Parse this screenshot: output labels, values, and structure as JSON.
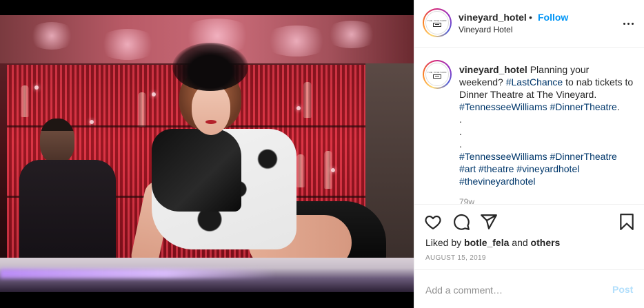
{
  "post": {
    "image_alt": "Performer in feathered hat reclining on a bar in front of a red tinsel backdrop"
  },
  "header": {
    "username": "vineyard_hotel",
    "separator": "•",
    "follow_label": "Follow",
    "location": "Vineyard Hotel",
    "avatar_logo_text": "THE VINEYARD"
  },
  "caption": {
    "username": "vineyard_hotel",
    "text_1": " Planning your weekend? ",
    "tag_1": "#LastChance",
    "text_2": " to nab tickets to Dinner Theatre at The Vineyard.",
    "tag_2": "#TennesseeWilliams",
    "tag_3": "#DinnerTheatre",
    "period": ".",
    "dot_1": ".",
    "dot_2": ".",
    "dot_3": ".",
    "tag_4": "#TennesseeWilliams",
    "tag_5": "#DinnerTheatre",
    "tag_6": "#art",
    "tag_7": "#theatre",
    "tag_8": "#vineyardhotel",
    "tag_9": "#thevineyardhotel",
    "time_ago": "79w"
  },
  "actions": {
    "like_icon": "heart-icon",
    "comment_icon": "comment-icon",
    "share_icon": "share-icon",
    "save_icon": "bookmark-icon"
  },
  "likes": {
    "prefix": "Liked by ",
    "user": "botle_fela",
    "middle": " and ",
    "others": "others"
  },
  "date": "AUGUST 15, 2019",
  "comment": {
    "placeholder": "Add a comment…",
    "post_label": "Post"
  },
  "colors": {
    "link": "#00376b",
    "follow": "#0095f6",
    "post_disabled": "#b2dffc",
    "muted": "#8e8e8e"
  }
}
